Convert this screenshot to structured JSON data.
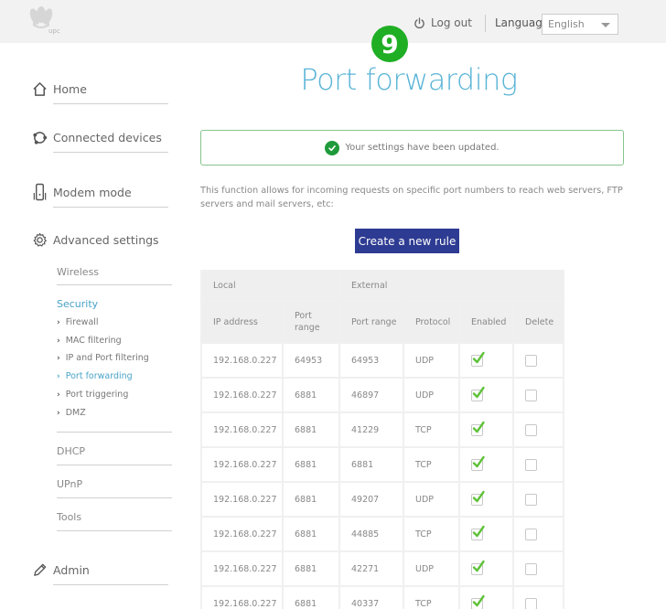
{
  "header": {
    "logo_text": "upc",
    "logout_label": "Log out",
    "language_label": "Language",
    "language_selected": "English"
  },
  "step_badge": "9",
  "sidebar": {
    "main_items": [
      {
        "label": "Home",
        "icon": "home-icon"
      },
      {
        "label": "Connected devices",
        "icon": "connected-devices-icon"
      },
      {
        "label": "Modem mode",
        "icon": "modem-icon"
      },
      {
        "label": "Advanced settings",
        "icon": "gear-icon"
      },
      {
        "label": "Admin",
        "icon": "pencil-icon"
      }
    ],
    "advanced_sub": {
      "wireless": "Wireless",
      "security": "Security",
      "security_items": [
        "Firewall",
        "MAC filtering",
        "IP and Port filtering",
        "Port forwarding",
        "Port triggering",
        "DMZ"
      ],
      "active_security_item": "Port forwarding",
      "dhcp": "DHCP",
      "upnp": "UPnP",
      "tools": "Tools"
    }
  },
  "main": {
    "title": "Port forwarding",
    "alert_message": "Your settings have been updated.",
    "description": "This function allows for incoming requests on specific port numbers to reach web servers, FTP servers and mail servers, etc:",
    "create_button": "Create a new rule",
    "colors": {
      "title": "#5ab4d6",
      "button": "#2d3b92",
      "success": "#1f9a3a"
    }
  },
  "table": {
    "group_headers": {
      "local": "Local",
      "external": "External"
    },
    "columns": [
      "IP address",
      "Port range",
      "Port range",
      "Protocol",
      "Enabled",
      "Delete"
    ],
    "rows": [
      {
        "ip": "192.168.0.227",
        "local_port": "64953",
        "external_port": "64953",
        "protocol": "UDP",
        "enabled": true,
        "delete": false
      },
      {
        "ip": "192.168.0.227",
        "local_port": "6881",
        "external_port": "46897",
        "protocol": "UDP",
        "enabled": true,
        "delete": false
      },
      {
        "ip": "192.168.0.227",
        "local_port": "6881",
        "external_port": "41229",
        "protocol": "TCP",
        "enabled": true,
        "delete": false
      },
      {
        "ip": "192.168.0.227",
        "local_port": "6881",
        "external_port": "6881",
        "protocol": "TCP",
        "enabled": true,
        "delete": false
      },
      {
        "ip": "192.168.0.227",
        "local_port": "6881",
        "external_port": "49207",
        "protocol": "UDP",
        "enabled": true,
        "delete": false
      },
      {
        "ip": "192.168.0.227",
        "local_port": "6881",
        "external_port": "44885",
        "protocol": "TCP",
        "enabled": true,
        "delete": false
      },
      {
        "ip": "192.168.0.227",
        "local_port": "6881",
        "external_port": "42271",
        "protocol": "UDP",
        "enabled": true,
        "delete": false
      },
      {
        "ip": "192.168.0.227",
        "local_port": "6881",
        "external_port": "40337",
        "protocol": "TCP",
        "enabled": true,
        "delete": false
      }
    ]
  }
}
